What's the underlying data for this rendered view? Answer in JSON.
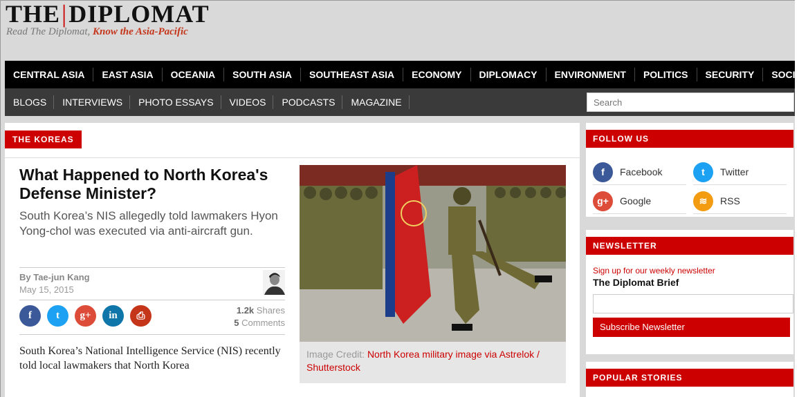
{
  "site": {
    "name_left": "THE",
    "name_right": "DIPLOMAT",
    "tagline_pre": "Read The Diplomat,",
    "tagline_em": "Know the Asia-Pacific"
  },
  "nav_primary": [
    "CENTRAL ASIA",
    "EAST ASIA",
    "OCEANIA",
    "SOUTH ASIA",
    "SOUTHEAST ASIA",
    "ECONOMY",
    "DIPLOMACY",
    "ENVIRONMENT",
    "POLITICS",
    "SECURITY",
    "SOCIETY"
  ],
  "nav_secondary": [
    "BLOGS",
    "INTERVIEWS",
    "PHOTO ESSAYS",
    "VIDEOS",
    "PODCASTS",
    "MAGAZINE"
  ],
  "search": {
    "placeholder": "Search"
  },
  "article": {
    "category": "THE KOREAS",
    "title": "What Happened to North Korea's Defense Minister?",
    "subtitle": "South Korea’s NIS allegedly told lawmakers Hyon Yong-chol was executed via anti-aircraft gun.",
    "byline": "By Tae-jun Kang",
    "date": "May 15, 2015",
    "shares_count": "1.2k",
    "shares_label": "Shares",
    "comments_count": "5",
    "comments_label": "Comments",
    "body_excerpt": "South Korea’s National Intelligence Service (NIS) recently told local lawmakers that North Korea",
    "image_credit_label": "Image Credit:",
    "image_credit_link": "North Korea military image via Astrelok / Shutterstock"
  },
  "share_buttons": [
    {
      "name": "facebook",
      "glyph": "f",
      "color": "#3b5998"
    },
    {
      "name": "twitter",
      "glyph": "t",
      "color": "#1da1f2"
    },
    {
      "name": "google-plus",
      "glyph": "g+",
      "color": "#dd4b39"
    },
    {
      "name": "linkedin",
      "glyph": "in",
      "color": "#0e76a8"
    },
    {
      "name": "print",
      "glyph": "⎙",
      "color": "#c4351a"
    }
  ],
  "sidebar": {
    "follow_title": "FOLLOW US",
    "follow": [
      {
        "label": "Facebook",
        "glyph": "f",
        "color": "#3b5998"
      },
      {
        "label": "Twitter",
        "glyph": "t",
        "color": "#1da1f2"
      },
      {
        "label": "Google",
        "glyph": "g+",
        "color": "#dd4b39"
      },
      {
        "label": "RSS",
        "glyph": "≋",
        "color": "#f39c12"
      }
    ],
    "newsletter_title": "NEWSLETTER",
    "newsletter_signup": "Sign up for our weekly newsletter",
    "newsletter_name": "The Diplomat Brief",
    "newsletter_button": "Subscribe Newsletter",
    "popular_title": "POPULAR STORIES"
  },
  "colors": {
    "accent": "#cc0000",
    "nav_dark": "#000000",
    "nav_sub": "#3a3a3a"
  }
}
